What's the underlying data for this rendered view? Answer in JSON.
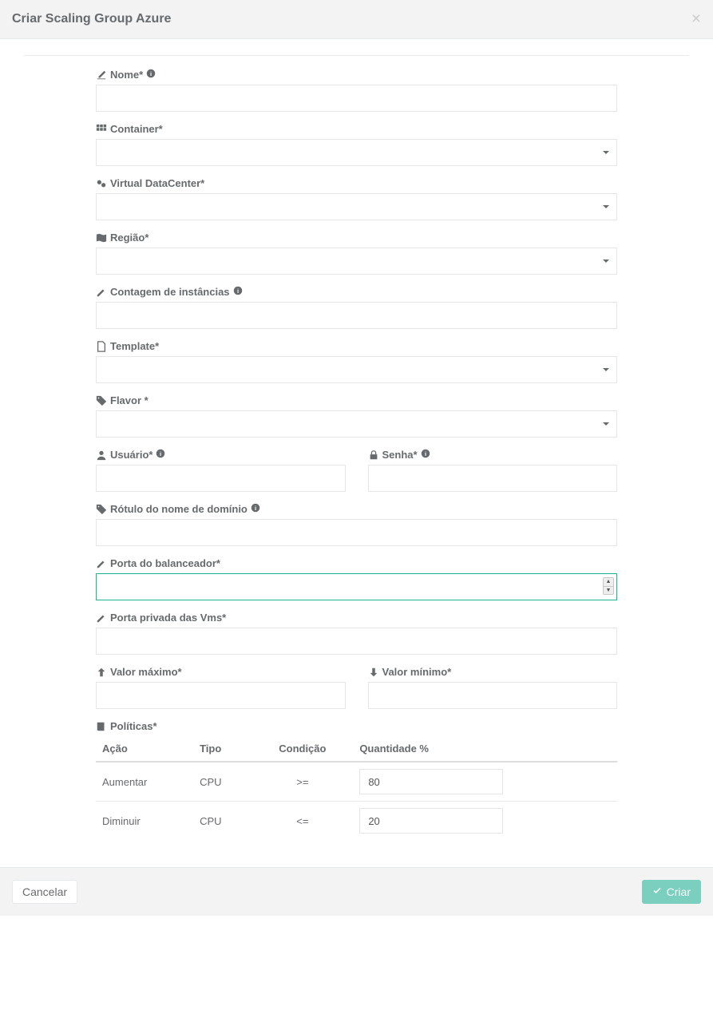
{
  "header": {
    "title": "Criar Scaling Group Azure"
  },
  "labels": {
    "name": "Nome*",
    "container": "Container*",
    "vdc": "Virtual DataCenter*",
    "region": "Região*",
    "instances": "Contagem de instâncias",
    "template": "Template*",
    "flavor": "Flavor *",
    "user": "Usuário*",
    "password": "Senha*",
    "domain": "Rótulo do nome de domínio",
    "lb_port": "Porta do balanceador*",
    "vm_port": "Porta privada das Vms*",
    "max": "Valor máximo*",
    "min": "Valor mínimo*",
    "policies": "Políticas*"
  },
  "table": {
    "headers": {
      "action": "Ação",
      "type": "Tipo",
      "condition": "Condição",
      "amount": "Quantidade %"
    },
    "rows": [
      {
        "action": "Aumentar",
        "type": "CPU",
        "condition": ">=",
        "amount": "80"
      },
      {
        "action": "Diminuir",
        "type": "CPU",
        "condition": "<=",
        "amount": "20"
      }
    ]
  },
  "footer": {
    "cancel": "Cancelar",
    "create": "Criar"
  }
}
